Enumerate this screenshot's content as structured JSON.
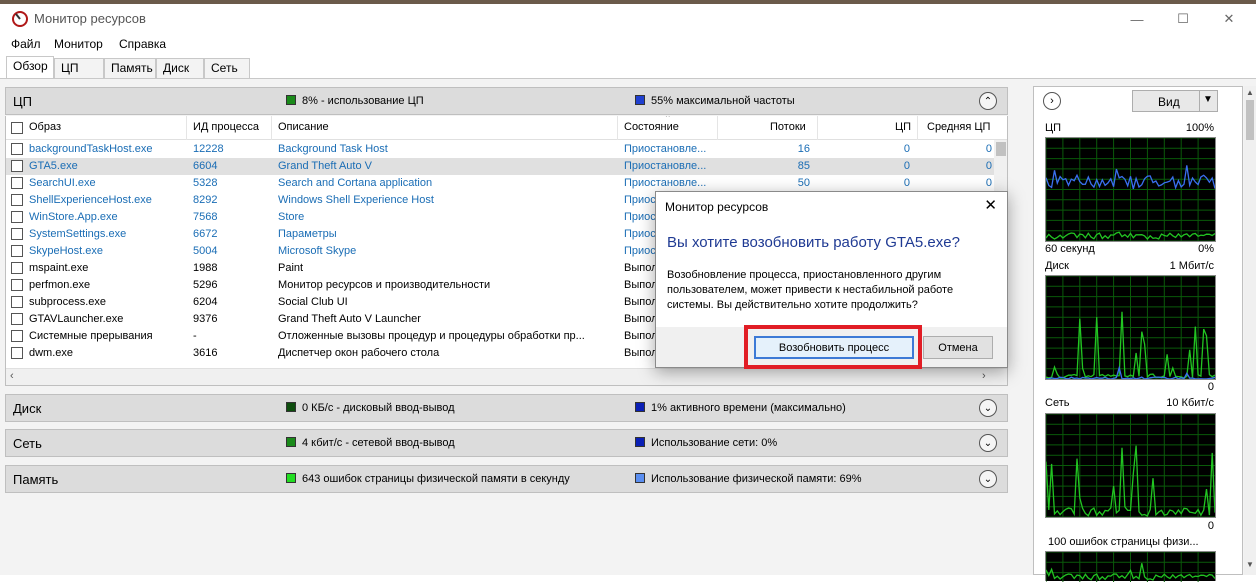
{
  "window": {
    "title": "Монитор ресурсов"
  },
  "menu": [
    "Файл",
    "Монитор",
    "Справка"
  ],
  "tabs": [
    "Обзор",
    "ЦП",
    "Память",
    "Диск",
    "Сеть"
  ],
  "cpu_section": {
    "title": "ЦП",
    "stat1": "8% - использование ЦП",
    "stat2": "55% максимальной частоты",
    "columns": [
      "Образ",
      "ИД процесса",
      "Описание",
      "Состояние",
      "Потоки",
      "ЦП",
      "Средняя ЦП"
    ],
    "rows": [
      {
        "image": "backgroundTaskHost.exe",
        "pid": "12228",
        "desc": "Background Task Host",
        "state": "Приостановле...",
        "threads": "16",
        "cpu": "0",
        "avg": "0"
      },
      {
        "image": "GTA5.exe",
        "pid": "6604",
        "desc": "Grand Theft Auto V",
        "state": "Приостановле...",
        "threads": "85",
        "cpu": "0",
        "avg": "0"
      },
      {
        "image": "SearchUI.exe",
        "pid": "5328",
        "desc": "Search and Cortana application",
        "state": "Приостановле...",
        "threads": "50",
        "cpu": "0",
        "avg": "0"
      },
      {
        "image": "ShellExperienceHost.exe",
        "pid": "8292",
        "desc": "Windows Shell Experience Host",
        "state": "Приост",
        "threads": "",
        "cpu": "",
        "avg": ""
      },
      {
        "image": "WinStore.App.exe",
        "pid": "7568",
        "desc": "Store",
        "state": "Приост",
        "threads": "",
        "cpu": "",
        "avg": ""
      },
      {
        "image": "SystemSettings.exe",
        "pid": "6672",
        "desc": "Параметры",
        "state": "Приост",
        "threads": "",
        "cpu": "",
        "avg": ""
      },
      {
        "image": "SkypeHost.exe",
        "pid": "5004",
        "desc": "Microsoft Skype",
        "state": "Приост",
        "threads": "",
        "cpu": "",
        "avg": ""
      },
      {
        "image": "mspaint.exe",
        "pid": "1988",
        "desc": "Paint",
        "state": "Выпол",
        "threads": "",
        "cpu": "",
        "avg": ""
      },
      {
        "image": "perfmon.exe",
        "pid": "5296",
        "desc": "Монитор ресурсов и производительности",
        "state": "Выпол",
        "threads": "",
        "cpu": "",
        "avg": ""
      },
      {
        "image": "subprocess.exe",
        "pid": "6204",
        "desc": "Social Club UI",
        "state": "Выпол",
        "threads": "",
        "cpu": "",
        "avg": ""
      },
      {
        "image": "GTAVLauncher.exe",
        "pid": "9376",
        "desc": "Grand Theft Auto V Launcher",
        "state": "Выпол",
        "threads": "",
        "cpu": "",
        "avg": ""
      },
      {
        "image": "Системные прерывания",
        "pid": "-",
        "desc": "Отложенные вызовы процедур и процедуры обработки пр...",
        "state": "Выпол",
        "threads": "",
        "cpu": "",
        "avg": ""
      },
      {
        "image": "dwm.exe",
        "pid": "3616",
        "desc": "Диспетчер окон рабочего стола",
        "state": "Выпол",
        "threads": "",
        "cpu": "",
        "avg": ""
      }
    ]
  },
  "sections": [
    {
      "title": "Диск",
      "stat1": "0 КБ/с - дисковый ввод-вывод",
      "stat2": "1% активного времени (максимально)"
    },
    {
      "title": "Сеть",
      "stat1": "4 кбит/с - сетевой ввод-вывод",
      "stat2": "Использование сети: 0%"
    },
    {
      "title": "Память",
      "stat1": "643 ошибок страницы физической памяти в секунду",
      "stat2": "Использование физической памяти: 69%"
    }
  ],
  "right_panel": {
    "view_label": "Вид",
    "graphs": [
      {
        "label": "ЦП",
        "max": "100%",
        "bottom_left": "60 секунд",
        "bottom_right": "0%"
      },
      {
        "label": "Диск",
        "max": "1 Мбит/с",
        "bottom_left": "",
        "bottom_right": "0"
      },
      {
        "label": "Сеть",
        "max": "10 Кбит/с",
        "bottom_left": "",
        "bottom_right": "0"
      },
      {
        "label": "100 ошибок страницы физи...",
        "max": "",
        "bottom_left": "",
        "bottom_right": ""
      }
    ]
  },
  "dialog": {
    "title": "Монитор ресурсов",
    "question": "Вы хотите возобновить работу GTA5.exe?",
    "body": "Возобновление процесса, приостановленного другим пользователем, может привести к нестабильной работе системы. Вы действительно хотите продолжить?",
    "confirm": "Возобновить процесс",
    "cancel": "Отмена"
  },
  "colors": {
    "highlight": "#e11d25",
    "link_blue": "#1a6db5",
    "graph_bg": "#000000",
    "graph_green": "#22c422",
    "graph_blue": "#3a6ff0"
  }
}
